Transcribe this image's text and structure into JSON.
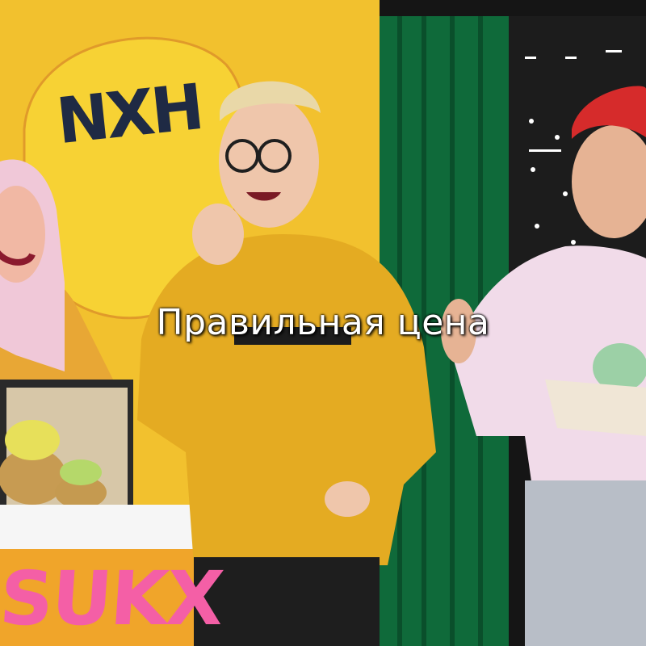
{
  "video": {
    "subtitle": "Правильная цена",
    "backdrop_sign_text": "NXH",
    "counter_sign_text": "SUKX"
  },
  "colors": {
    "yellow_wall": "#f2c12e",
    "green_curtain": "#0f6a3a",
    "sweater_yellow": "#e4ab22",
    "pink_shirt": "#f1dbe9",
    "red_beanie": "#d62b2b",
    "counter_pink": "#f45fa6"
  }
}
